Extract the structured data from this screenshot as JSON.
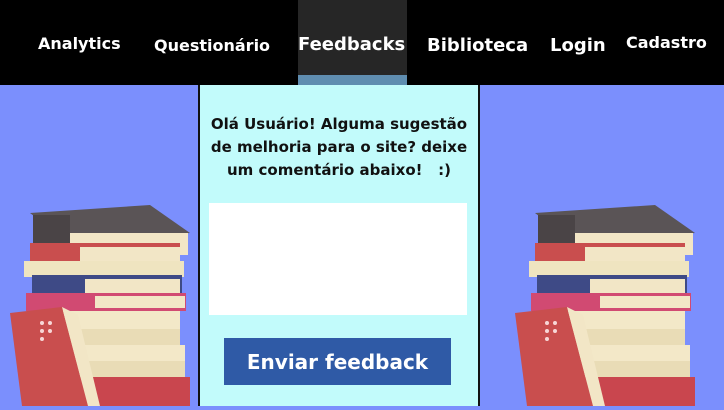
{
  "nav": {
    "items": [
      {
        "label": "Analytics"
      },
      {
        "label": "Questionário"
      },
      {
        "label": "Feedbacks",
        "active": true
      },
      {
        "label": "Biblioteca"
      },
      {
        "label": "Login"
      },
      {
        "label": "Cadastro"
      }
    ]
  },
  "feedback": {
    "prompt_line1": "Olá Usuário! Alguma sugestão",
    "prompt_line2": "de melhoria para o site? deixe",
    "prompt_line3": "um comentário abaixo!   :)",
    "textarea_value": "",
    "submit_label": "Enviar feedback"
  },
  "colors": {
    "navbar": "#000000",
    "background": "#7b8ffd",
    "panel": "#c2fbfb",
    "button": "#2f5aa6",
    "active_tab_indicator": "#5f8db0"
  },
  "decorations": [
    "books-stack-illustration-left",
    "books-stack-illustration-right"
  ]
}
